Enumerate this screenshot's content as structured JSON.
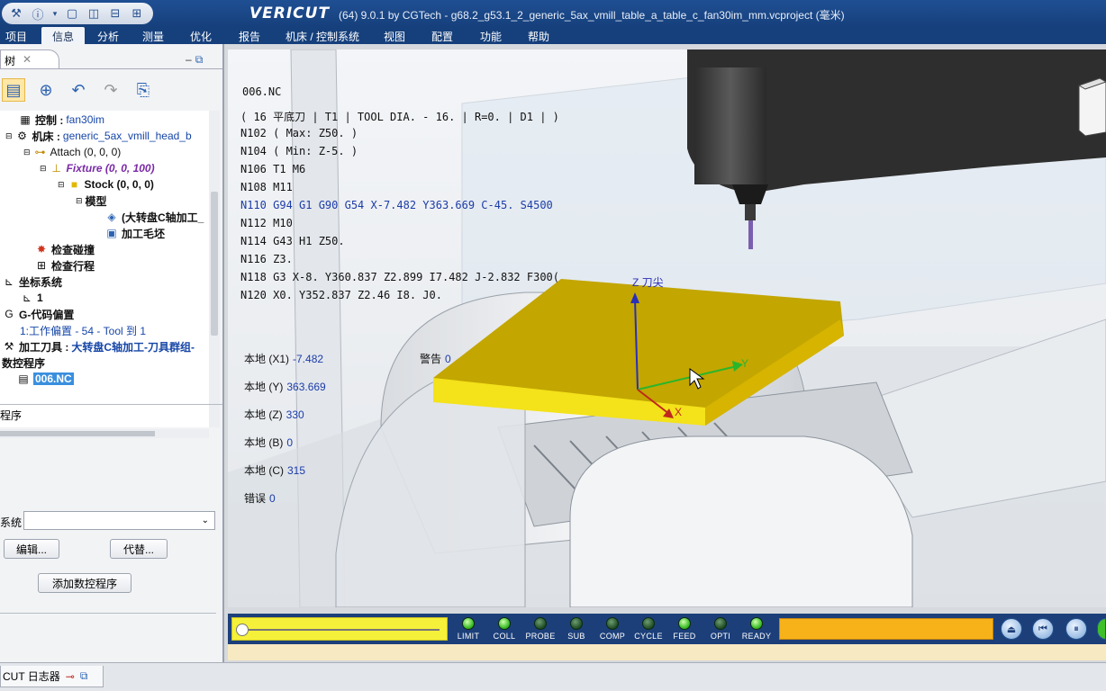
{
  "titlebar": {
    "app_logo": "VERICUT",
    "window_title": "(64)  9.0.1 by CGTech - g68.2_g53.1_2_generic_5ax_vmill_table_a_table_c_fan30im_mm.vcproject (毫米)",
    "quick_access_icons": [
      "tools-icon",
      "info-icon",
      "dropdown-icon",
      "layout-single-icon",
      "layout-split-icon",
      "layout-horizontal-icon",
      "layout-grid-icon"
    ]
  },
  "menu": {
    "items": [
      "项目",
      "信息",
      "分析",
      "测量",
      "优化",
      "报告",
      "机床 / 控制系统",
      "视图",
      "配置",
      "功能",
      "帮助"
    ],
    "active": "信息"
  },
  "left_panel": {
    "tab_label": "树",
    "tree": [
      {
        "icon": "control-icon",
        "label": "控制 :",
        "value": "fan30im"
      },
      {
        "icon": "machine-icon",
        "label": "机床 :",
        "value": "generic_5ax_vmill_head_b"
      },
      {
        "icon": "attach-icon",
        "label": "Attach (0, 0, 0)",
        "value": ""
      },
      {
        "icon": "fixture-icon",
        "label": "Fixture (0, 0, 100)",
        "value": ""
      },
      {
        "icon": "stock-icon",
        "label": "Stock (0, 0, 0)",
        "value": ""
      },
      {
        "icon": "model-icon",
        "label": "模型",
        "value": ""
      },
      {
        "icon": "model-file-icon",
        "label": "(大转盘C轴加工_",
        "value": ""
      },
      {
        "icon": "stock-blank-icon",
        "label": "加工毛坯",
        "value": ""
      },
      {
        "icon": "collision-check-icon",
        "label": "检查碰撞",
        "value": ""
      },
      {
        "icon": "travel-check-icon",
        "label": "检查行程",
        "value": ""
      },
      {
        "icon": "coordinate-system-icon",
        "label": "坐标系统",
        "value": ""
      },
      {
        "icon": "csys-item-icon",
        "label": "1",
        "value": ""
      },
      {
        "icon": "gcode-offset-icon",
        "label": "G-代码偏置",
        "value": ""
      },
      {
        "icon": "",
        "label": "1:工作偏置 - 54 - Tool 到 1",
        "value": ""
      },
      {
        "icon": "tooling-icon",
        "label": "加工刀具 :",
        "value": "大转盘C轴加工-刀具群组-"
      },
      {
        "icon": "",
        "label": "数控程序",
        "value": ""
      },
      {
        "icon": "nc-file-icon",
        "label": "006.NC",
        "value": ""
      }
    ],
    "program_section_label": "程序",
    "coord_system_label": "系统",
    "edit_button": "编辑...",
    "replace_button": "代替...",
    "add_program_button": "添加数控程序"
  },
  "logger_tab": {
    "label": "CUT 日志器"
  },
  "viewport": {
    "nc_filename": "006.NC",
    "nc_lines": [
      "( 16 平底刀 | T1 | TOOL DIA. - 16. | R=0. | D1 | )",
      "N102 ( Max:  Z50. )",
      "N104 ( Min:  Z-5. )",
      "N106 T1 M6",
      "N108 M11",
      "N110 G94 G1 G90 G54 X-7.482 Y363.669 C-45. S4500",
      "N112 M10",
      "N114 G43 H1 Z50.",
      "N116 Z3.",
      "N118 G3 X-8. Y360.837 Z2.899 I7.482 J-2.832 F300(",
      "N120 X0. Y352.837 Z2.46 I8. J0."
    ],
    "highlight_line_index": 5,
    "readouts": [
      {
        "label": "本地 (X1)",
        "value": "-7.482"
      },
      {
        "label": "本地 (Y)",
        "value": "363.669"
      },
      {
        "label": "本地 (Z)",
        "value": "330"
      },
      {
        "label": "本地 (B)",
        "value": "0"
      },
      {
        "label": "本地 (C)",
        "value": "315"
      },
      {
        "label": "错误",
        "value": "0"
      }
    ],
    "warning": {
      "label": "警告",
      "value": "0"
    },
    "axis_labels": {
      "z": "Z 刀尖",
      "y": "Y",
      "x": "X"
    },
    "colors": {
      "stock": "#d6b400",
      "stock_top": "#c3a600",
      "stock_side": "#f4e21a",
      "axis_z": "#2a2fb8",
      "axis_y": "#2bb52b",
      "axis_x": "#c0281e"
    }
  },
  "playback": {
    "leds": [
      {
        "label": "LIMIT",
        "on": true
      },
      {
        "label": "COLL",
        "on": true
      },
      {
        "label": "PROBE",
        "on": false
      },
      {
        "label": "SUB",
        "on": false
      },
      {
        "label": "COMP",
        "on": false
      },
      {
        "label": "CYCLE",
        "on": false
      },
      {
        "label": "FEED",
        "on": true
      },
      {
        "label": "OPTI",
        "on": false
      },
      {
        "label": "READY",
        "on": true
      }
    ],
    "controls": [
      "reset-model-icon",
      "rewind-icon",
      "pause-icon",
      "play-icon"
    ],
    "slider_position": 0,
    "colors": {
      "slider": "#f5f03a",
      "progress": "#f7b21a"
    }
  }
}
